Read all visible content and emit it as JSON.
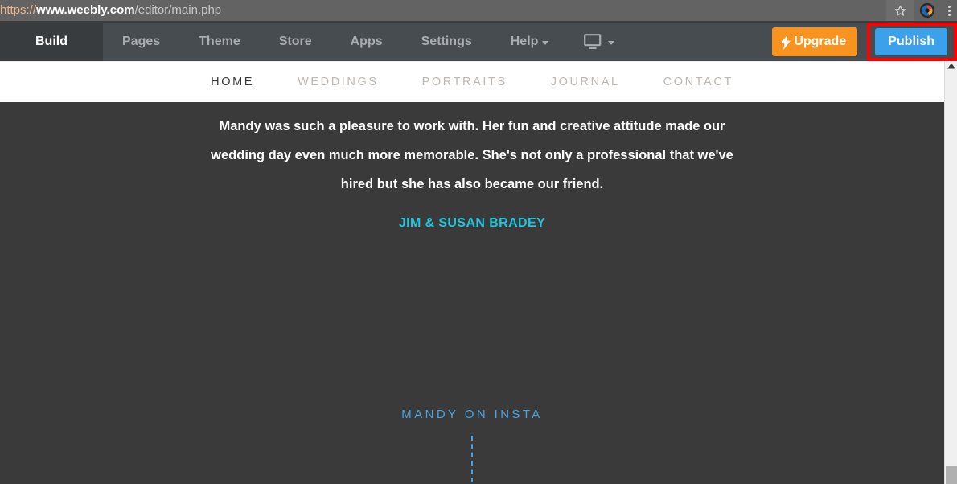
{
  "browser": {
    "url": {
      "scheme": "https://",
      "host": "www.weebly.com",
      "path": "/editor/main.php"
    },
    "icons": {
      "bookmark": "star-icon",
      "profile": "profile-icon",
      "menu": "kebab-menu-icon"
    }
  },
  "editor_toolbar": {
    "tabs": [
      {
        "label": "Build",
        "active": true
      },
      {
        "label": "Pages",
        "active": false
      },
      {
        "label": "Theme",
        "active": false
      },
      {
        "label": "Store",
        "active": false
      },
      {
        "label": "Apps",
        "active": false
      },
      {
        "label": "Settings",
        "active": false
      },
      {
        "label": "Help",
        "active": false,
        "has_caret": true
      }
    ],
    "device_selector": "desktop-monitor-icon",
    "upgrade_label": "Upgrade",
    "publish_label": "Publish",
    "colors": {
      "toolbar_bg": "#464c4f",
      "active_tab_bg": "#383c3e",
      "upgrade_orange": "#f7931e",
      "publish_blue": "#3ba1ea",
      "highlight_red": "#ff0000"
    }
  },
  "site": {
    "nav": [
      {
        "label": "HOME",
        "active": true
      },
      {
        "label": "WEDDINGS",
        "active": false
      },
      {
        "label": "PORTRAITS",
        "active": false
      },
      {
        "label": "JOURNAL",
        "active": false
      },
      {
        "label": "CONTACT",
        "active": false
      }
    ],
    "testimonial": {
      "line1": "Mandy was such a pleasure to work with. Her fun and creative attitude made our",
      "line2": "wedding day even much more memorable. She's not only a professional that we've",
      "line3": "hired but she has also became our friend.",
      "author": "JIM & SUSAN BRADEY"
    },
    "instagram": {
      "label": "MANDY ON INSTA"
    },
    "colors": {
      "canvas_bg": "#3a3a3a",
      "author_cyan": "#22c3dd",
      "insta_blue": "#4aa3df"
    }
  }
}
